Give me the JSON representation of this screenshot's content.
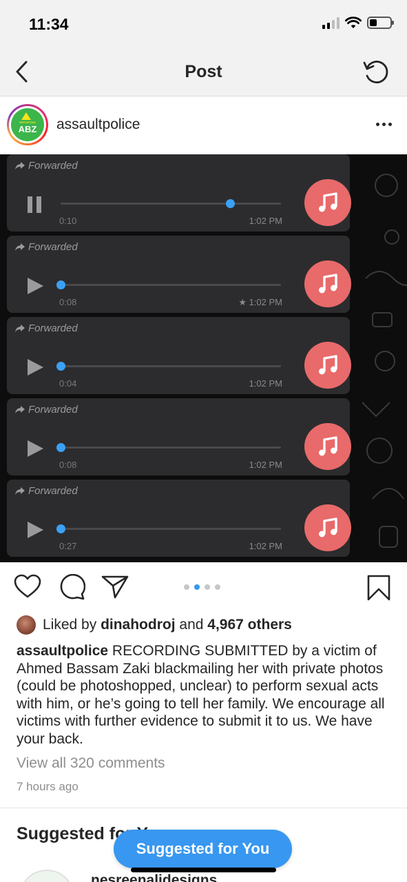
{
  "status_bar": {
    "time": "11:34",
    "icons": [
      "signal-icon",
      "wifi-icon",
      "battery-icon"
    ]
  },
  "nav": {
    "title": "Post",
    "back_icon": "chevron-left-icon",
    "refresh_icon": "refresh-icon"
  },
  "post": {
    "username": "assaultpolice",
    "avatar_text": "ABZ",
    "avatar_subtext": "REPORTING",
    "media": {
      "voice_messages": [
        {
          "label": "Forwarded",
          "state": "pause",
          "duration": "0:10",
          "time": "1:02 PM",
          "progress": 0.77,
          "starred": false
        },
        {
          "label": "Forwarded",
          "state": "play",
          "duration": "0:08",
          "time": "★ 1:02 PM",
          "progress": 0.0,
          "starred": true
        },
        {
          "label": "Forwarded",
          "state": "play",
          "duration": "0:04",
          "time": "1:02 PM",
          "progress": 0.0,
          "starred": false
        },
        {
          "label": "Forwarded",
          "state": "play",
          "duration": "0:08",
          "time": "1:02 PM",
          "progress": 0.0,
          "starred": false
        },
        {
          "label": "Forwarded",
          "state": "play",
          "duration": "0:27",
          "time": "1:02 PM",
          "progress": 0.0,
          "starred": false
        }
      ],
      "carousel": {
        "count": 4,
        "active": 1
      }
    },
    "likes": {
      "prefix": "Liked by ",
      "user": "dinahodroj",
      "middle": " and ",
      "others": "4,967 others"
    },
    "caption": {
      "username": "assaultpolice",
      "text": " RECORDING SUBMITTED by a victim of Ahmed Bassam Zaki blackmailing her with private photos (could be photoshopped, unclear) to perform sexual acts with him, or he’s going to tell her family. We encourage all victims with further evidence to submit it to us. We have your back."
    },
    "view_comments": "View all 320 comments",
    "time_ago": "7 hours ago"
  },
  "suggested": {
    "heading": "Suggested for You",
    "pill_label": "Suggested for You",
    "first_account": "nesreenalidesigns"
  },
  "colors": {
    "accent": "#3897f0",
    "music_icon_bg": "#e86a6a",
    "voice_bg": "#2c2c2e",
    "progress_knob": "#3ba1f5"
  }
}
